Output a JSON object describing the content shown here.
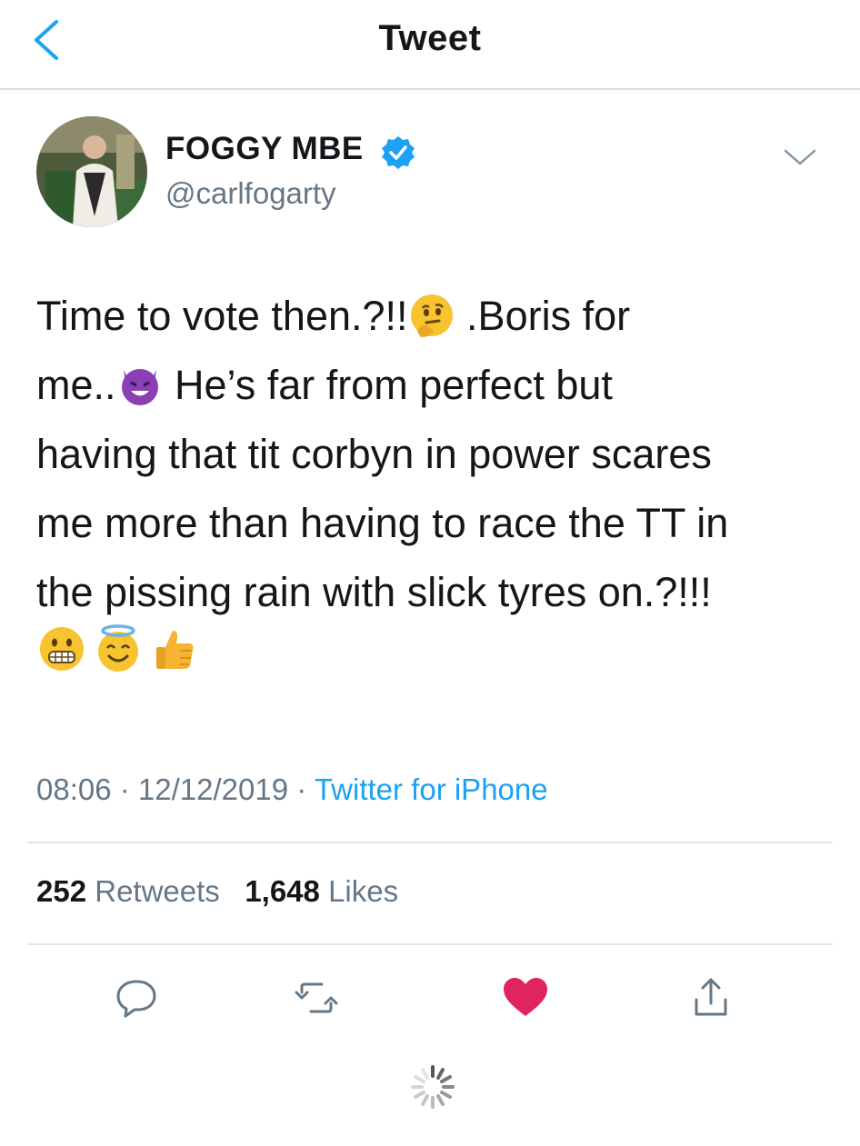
{
  "header": {
    "title": "Tweet",
    "back_icon": "chevron-left-icon"
  },
  "author": {
    "display_name": "FOGGY  MBE",
    "handle": "@carlfogarty",
    "verified": true,
    "verified_color": "#1da1f2"
  },
  "tweet": {
    "line1_a": "Time to vote then.?!!",
    "line1_b": " .Boris for",
    "line2_a": "me..",
    "line2_b": " He’s far from perfect but",
    "line3": "having that tit corbyn in power scares",
    "line4": "me more than having to race the TT in",
    "line5": "the pissing rain with slick tyres on.?!!!",
    "emojis_inline": [
      "thinking-face-emoji",
      "smiling-devil-emoji"
    ],
    "emojis_trailing": [
      "grimacing-face-emoji",
      "smiling-face-with-halo-emoji",
      "thumbs-up-emoji"
    ]
  },
  "meta": {
    "time": "08:06",
    "sep1": " · ",
    "date": "12/12/2019",
    "sep2": " · ",
    "source": "Twitter for iPhone"
  },
  "stats": {
    "retweets_count": "252",
    "retweets_label": "Retweets",
    "likes_count": "1,648",
    "likes_label": "Likes"
  },
  "actions": {
    "reply_icon": "reply-icon",
    "retweet_icon": "retweet-icon",
    "like_icon": "heart-icon",
    "like_active": true,
    "like_color": "#e0245e",
    "share_icon": "share-icon"
  },
  "colors": {
    "accent": "#1da1f2",
    "secondary_text": "#657786",
    "primary_text": "#14171a"
  }
}
